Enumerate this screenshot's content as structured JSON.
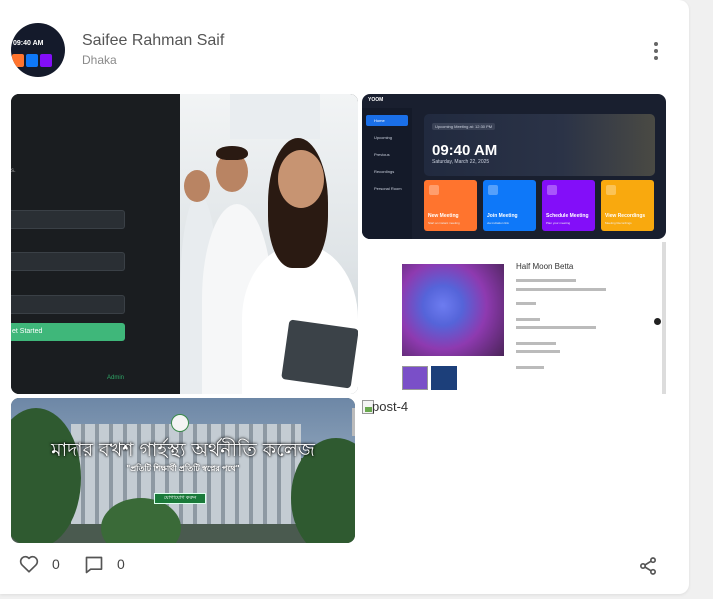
{
  "post": {
    "author": {
      "name": "Saifee Rahman Saif",
      "location": "Dhaka",
      "avatar_time": "09:40 AM"
    },
    "media": [
      {
        "kind": "image",
        "left_screen": {
          "fragment": "s.",
          "cta_label": "et Started",
          "footer_link": "Admin"
        }
      },
      {
        "kind": "image",
        "app_name": "YOOM",
        "nav": [
          "Home",
          "Upcoming",
          "Previous",
          "Recordings",
          "Personal Room"
        ],
        "upcoming_pill": "Upcoming Meeting at: 12:30 PM",
        "time": "09:40 AM",
        "date": "Saturday, March 22, 2025",
        "tiles": [
          {
            "title": "New Meeting",
            "subtitle": "Start an instant meeting",
            "color": "#ff742e"
          },
          {
            "title": "Join Meeting",
            "subtitle": "via invitation link",
            "color": "#0e78f9"
          },
          {
            "title": "Schedule Meeting",
            "subtitle": "Plan your meeting",
            "color": "#830ef9"
          },
          {
            "title": "View Recordings",
            "subtitle": "Meeting Recordings",
            "color": "#f9a90e"
          }
        ]
      },
      {
        "kind": "image",
        "product_title": "Half Moon Betta"
      },
      {
        "kind": "image",
        "college_name": "মাদার বখশ গার্হস্থ্য অর্থনীতি কলেজ",
        "tagline": "\"প্রতিটি শিক্ষার্থী প্রতিটি স্বপ্নের পথে\"",
        "button": "যোগাযোগ করুন"
      },
      {
        "kind": "broken-image",
        "alt": "post-4"
      }
    ],
    "actions": {
      "like_count": "0",
      "comment_count": "0"
    }
  },
  "colors": {
    "card_bg": "#ffffff",
    "page_bg": "#f0f0f0",
    "icon_gray": "#555555"
  }
}
